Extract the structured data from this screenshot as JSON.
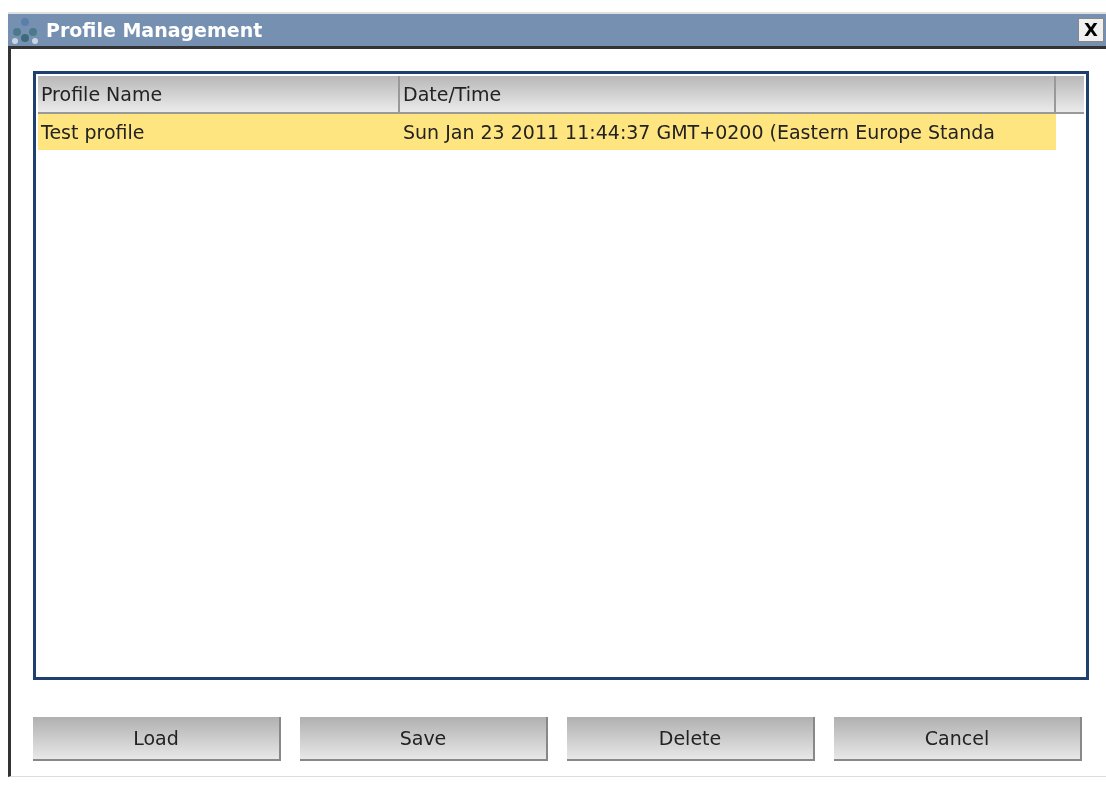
{
  "window": {
    "title": "Profile Management",
    "close": "X"
  },
  "table": {
    "columns": [
      "Profile Name",
      "Date/Time"
    ],
    "rows": [
      {
        "cells": [
          "Test profile",
          "Sun Jan 23 2011 11:44:37 GMT+0200 (Eastern Europe Standa"
        ],
        "selected": true
      }
    ]
  },
  "buttons": [
    "Load",
    "Save",
    "Delete",
    "Cancel"
  ]
}
